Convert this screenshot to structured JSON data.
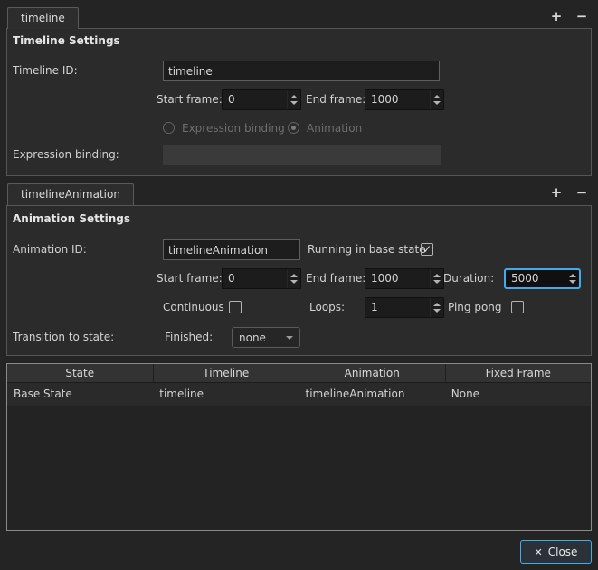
{
  "colors": {
    "accent": "#3daee9",
    "window_bg": "#242424",
    "pane_bg": "#2b2b2b",
    "field_bg": "#1d1d1d"
  },
  "icons": {
    "plus": "+",
    "minus": "−",
    "check": "✓",
    "close": "✕"
  },
  "timeline_panel": {
    "tab": "timeline",
    "section_title": "Timeline Settings",
    "timeline_id_label": "Timeline ID:",
    "timeline_id_value": "timeline",
    "start_frame_label": "Start frame:",
    "start_frame_value": "0",
    "end_frame_label": "End frame:",
    "end_frame_value": "1000",
    "expression_binding_radio_label": "Expression binding",
    "animation_radio_label": "Animation",
    "expression_binding_label": "Expression binding:",
    "expression_binding_value": ""
  },
  "animation_panel": {
    "tab": "timelineAnimation",
    "section_title": "Animation Settings",
    "animation_id_label": "Animation ID:",
    "animation_id_value": "timelineAnimation",
    "running_in_base_state_label": "Running in base state",
    "start_frame_label": "Start frame:",
    "start_frame_value": "0",
    "end_frame_label": "End frame:",
    "end_frame_value": "1000",
    "duration_label": "Duration:",
    "duration_value": "5000",
    "continuous_label": "Continuous",
    "loops_label": "Loops:",
    "loops_value": "1",
    "ping_pong_label": "Ping pong",
    "transition_to_state_label": "Transition to state:",
    "finished_label": "Finished:",
    "finished_value": "none"
  },
  "table": {
    "headers": [
      "State",
      "Timeline",
      "Animation",
      "Fixed Frame"
    ],
    "rows": [
      [
        "Base State",
        "timeline",
        "timelineAnimation",
        "None"
      ]
    ]
  },
  "footer": {
    "close_label": "Close"
  }
}
